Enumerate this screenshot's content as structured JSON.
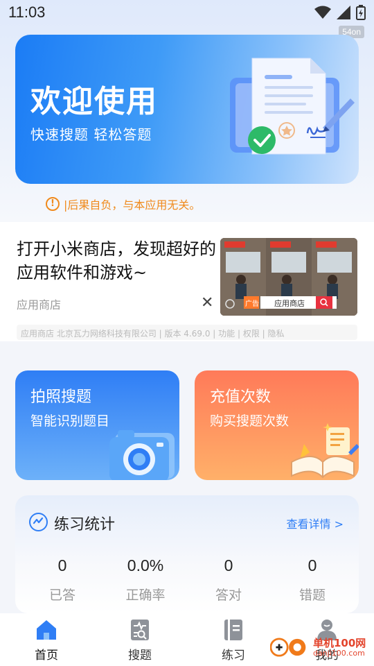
{
  "status_bar": {
    "time": "11:03",
    "fps": "54on"
  },
  "banner": {
    "title": "欢迎使用",
    "subtitle": "快速搜题 轻松答题"
  },
  "notice": {
    "text": "|后果自负，与本应用无关。"
  },
  "ad": {
    "headline": "打开小米商店，发现超好的应用软件和游戏~",
    "source": "应用商店",
    "image_search_label": "应用商店",
    "image_tag": "广告",
    "meta": "应用商店 北京瓦力网络科技有限公司 | 版本 4.69.0 | 功能 | 权限 | 隐私"
  },
  "cards": {
    "photo": {
      "title": "拍照搜题",
      "subtitle": "智能识别题目"
    },
    "recharge": {
      "title": "充值次数",
      "subtitle": "购买搜题次数"
    }
  },
  "stats": {
    "title": "练习统计",
    "detail_link": "查看详情 >",
    "items": [
      {
        "value": "0",
        "label": "已答"
      },
      {
        "value": "0.0%",
        "label": "正确率"
      },
      {
        "value": "0",
        "label": "答对"
      },
      {
        "value": "0",
        "label": "错题"
      }
    ]
  },
  "nav": {
    "items": [
      {
        "label": "首页"
      },
      {
        "label": "搜题"
      },
      {
        "label": "练习"
      },
      {
        "label": "我的"
      }
    ]
  },
  "watermark": {
    "name": "单机100网",
    "url": "danji100.com"
  }
}
